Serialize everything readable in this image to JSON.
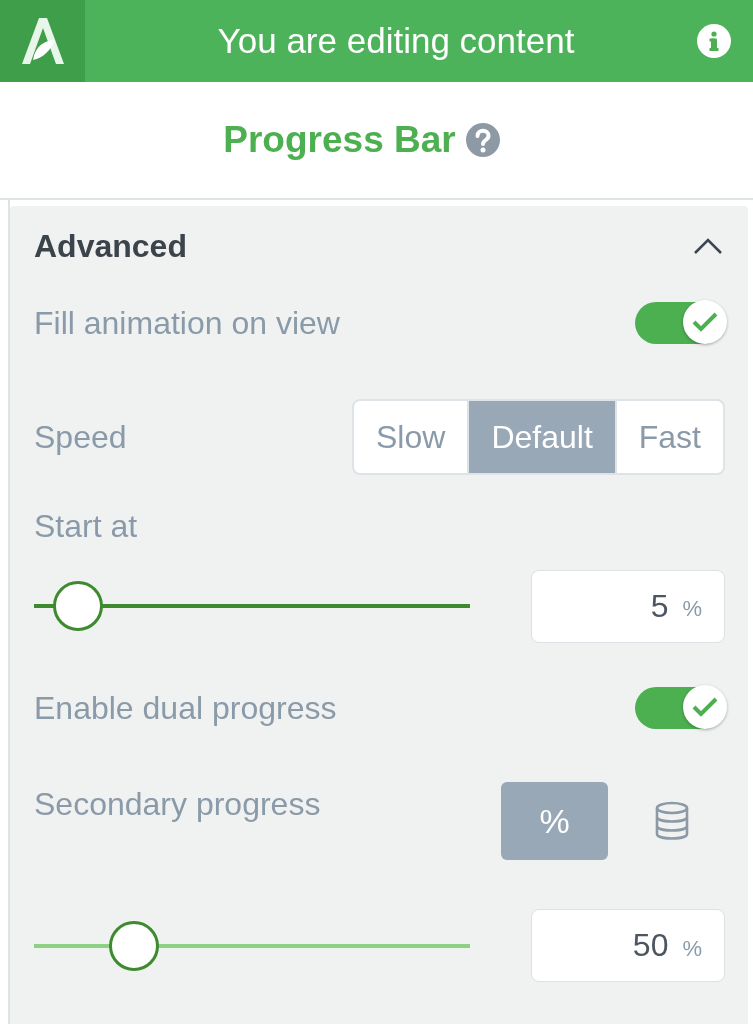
{
  "header": {
    "title": "You are editing content"
  },
  "block": {
    "title": "Progress Bar"
  },
  "section": {
    "title": "Advanced",
    "expanded": true,
    "rows": [
      {
        "kind": "toggle",
        "label": "Fill animation on view",
        "on": true
      },
      {
        "kind": "segmented",
        "label": "Speed",
        "options": [
          {
            "label": "Slow",
            "selected": false
          },
          {
            "label": "Default",
            "selected": true
          },
          {
            "label": "Fast",
            "selected": false
          }
        ]
      },
      {
        "kind": "label",
        "label": "Start at"
      },
      {
        "kind": "slider",
        "level": 0.1,
        "color": "#3d8a2f",
        "value": "5",
        "unit": "%"
      },
      {
        "kind": "toggle",
        "label": "Enable dual progress",
        "on": true
      },
      {
        "kind": "unit_picker",
        "label": "Secondary progress",
        "options": [
          {
            "kind": "text",
            "label": "%",
            "selected": true
          },
          {
            "kind": "icon",
            "selected": false
          }
        ]
      },
      {
        "kind": "slider",
        "level": 0.23,
        "color": "#8fd184",
        "value": "50",
        "unit": "%"
      }
    ]
  }
}
